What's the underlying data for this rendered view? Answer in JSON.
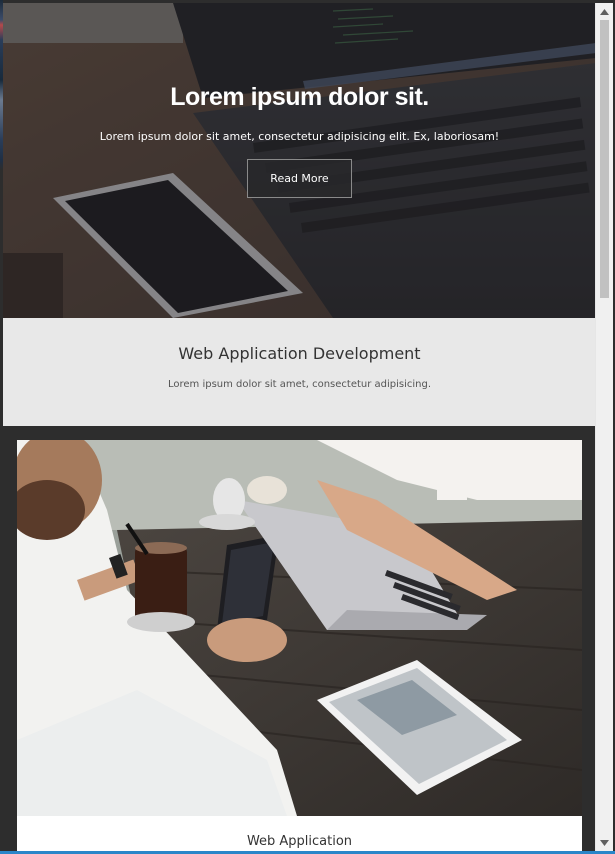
{
  "hero": {
    "title": "Lorem ipsum dolor sit.",
    "subtitle": "Lorem ipsum dolor sit amet, consectetur adipisicing elit. Ex, laboriosam!",
    "button_label": "Read More"
  },
  "feature": {
    "title": "Web Application Development",
    "subtitle": "Lorem ipsum dolor sit amet, consectetur adipisicing."
  },
  "card": {
    "caption": "Web Application"
  },
  "icons": {
    "scroll_up": "chevron-up-icon",
    "scroll_down": "chevron-down-icon"
  }
}
